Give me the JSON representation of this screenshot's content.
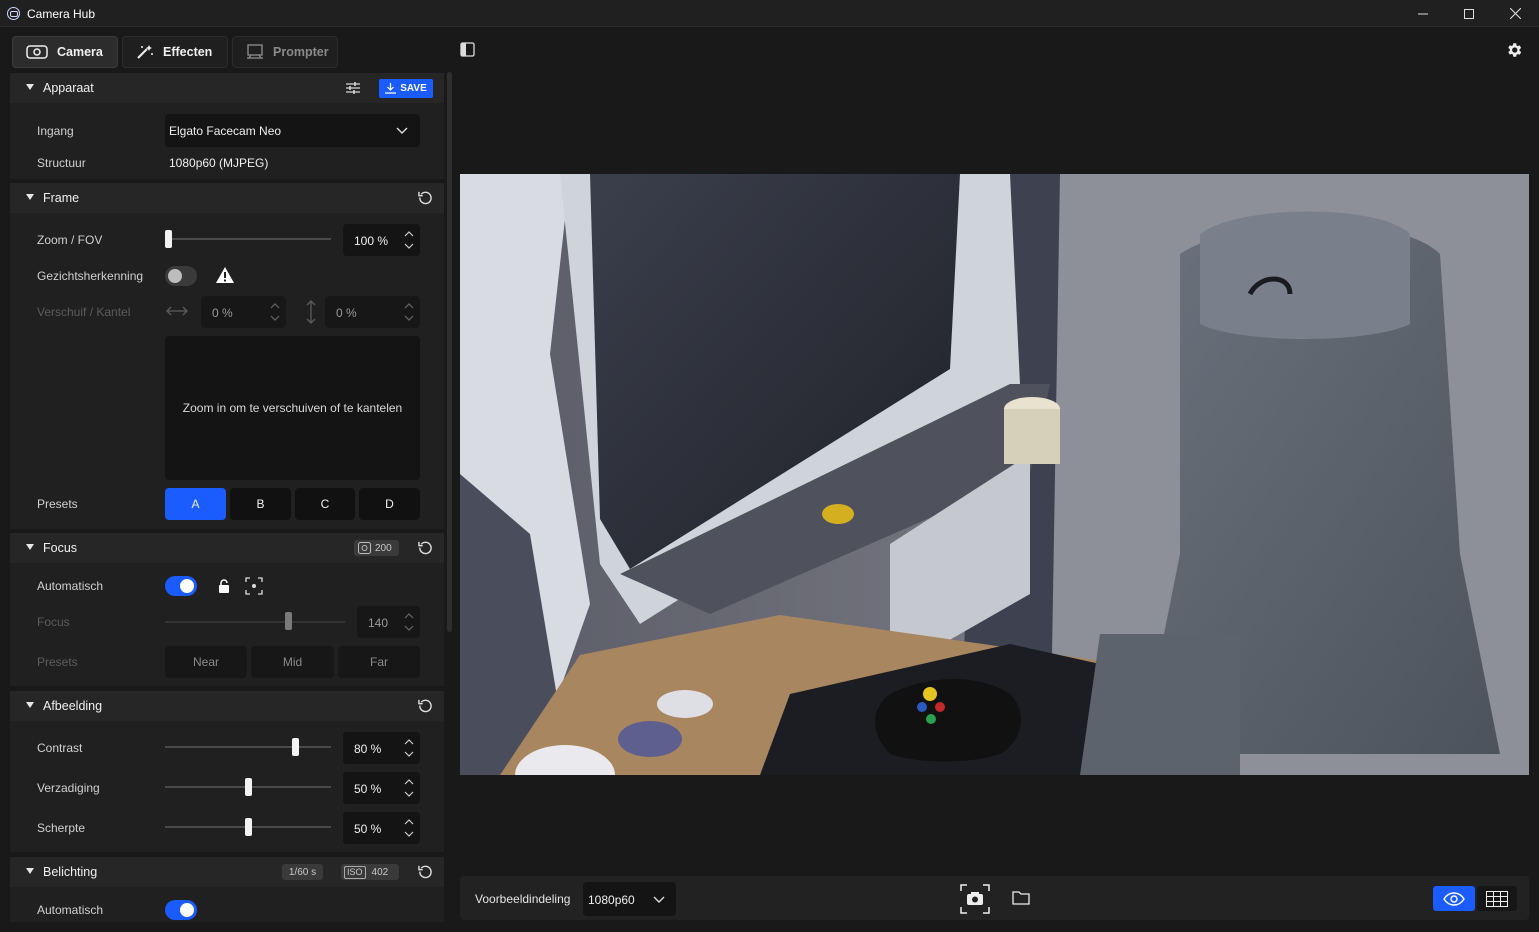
{
  "window": {
    "title": "Camera Hub"
  },
  "tabs": [
    {
      "label": "Camera",
      "icon": "camera-icon"
    },
    {
      "label": "Effecten",
      "icon": "magic-wand-icon"
    },
    {
      "label": "Prompter",
      "icon": "prompter-icon"
    }
  ],
  "apparaat": {
    "title": "Apparaat",
    "save_label": "SAVE",
    "ingang_label": "Ingang",
    "ingang_value": "Elgato Facecam Neo",
    "structuur_label": "Structuur",
    "structuur_value": "1080p60 (MJPEG)"
  },
  "frame": {
    "title": "Frame",
    "zoom_label": "Zoom / FOV",
    "zoom_value": "100 %",
    "zoom_level": 0.0,
    "face_label": "Gezichtsherkenning",
    "face_enabled": false,
    "pan_label": "Verschuif / Kantel",
    "pan_value": "0 %",
    "tilt_value": "0 %",
    "pan_hint": "Zoom in om te verschuiven of te kantelen",
    "presets_label": "Presets",
    "presets": [
      "A",
      "B",
      "C",
      "D"
    ],
    "selected_preset": "A"
  },
  "focus": {
    "title": "Focus",
    "badge_value": "200",
    "auto_label": "Automatisch",
    "auto_enabled": true,
    "focus_label": "Focus",
    "focus_value": "140",
    "presets_label": "Presets",
    "presets": [
      "Near",
      "Mid",
      "Far"
    ]
  },
  "afbeelding": {
    "title": "Afbeelding",
    "contrast_label": "Contrast",
    "contrast_value": "80 %",
    "contrast_level": 0.8,
    "verzadiging_label": "Verzadiging",
    "verzadiging_value": "50 %",
    "verzadiging_level": 0.5,
    "scherpte_label": "Scherpte",
    "scherpte_value": "50 %",
    "scherpte_level": 0.5
  },
  "belichting": {
    "title": "Belichting",
    "shutter": "1/60 s",
    "iso_label": "ISO",
    "iso_value": "402",
    "auto_label": "Automatisch",
    "auto_enabled": true
  },
  "bottombar": {
    "layout_label": "Voorbeeldindeling",
    "layout_value": "1080p60"
  },
  "colors": {
    "accent": "#1a5cff",
    "panel": "#202020",
    "header": "#262626"
  }
}
